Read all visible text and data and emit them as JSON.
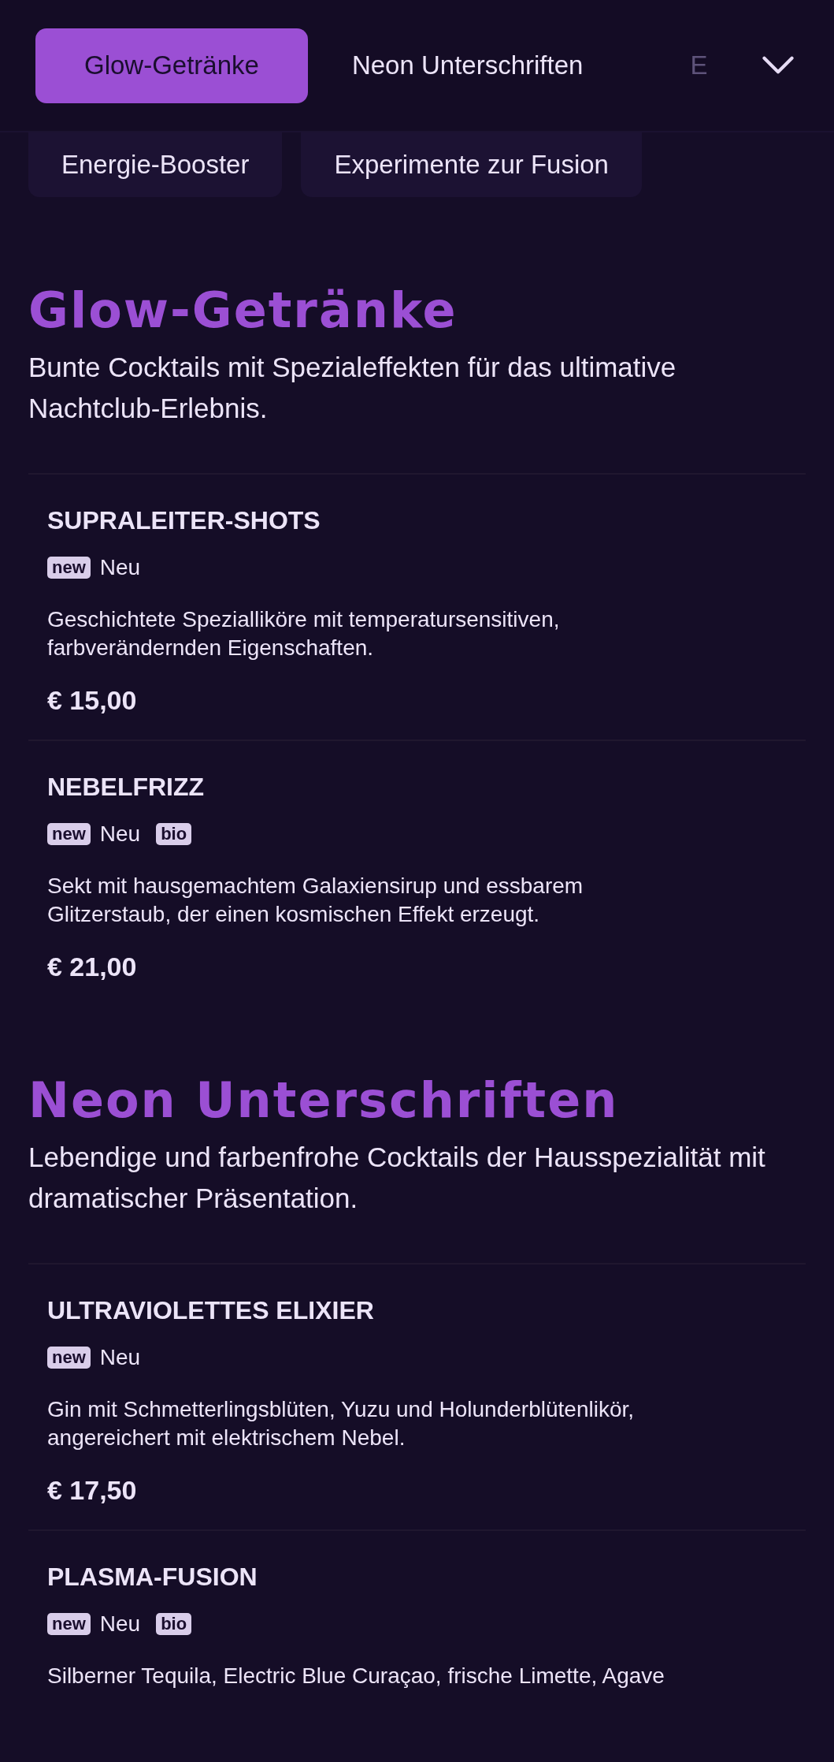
{
  "tabs": [
    {
      "label": "Glow-Getränke",
      "selected": true
    },
    {
      "label": "Neon Unterschriften",
      "selected": false
    },
    {
      "label": "E",
      "selected": false,
      "faded": true
    }
  ],
  "chips": [
    "Energie-Booster",
    "Experimente zur Fusion"
  ],
  "sections": [
    {
      "title": "Glow-Getränke",
      "description": "Bunte Cocktails mit Spezialeffekten für das ultimative Nachtclub-Erlebnis.",
      "items": [
        {
          "name": "SUPRALEITER-SHOTS",
          "tags": [
            {
              "badge": "new",
              "label": "Neu"
            }
          ],
          "description": "Geschichtete Spezialliköre mit temperatursensitiven, farbverändernden Eigenschaften.",
          "price": "€ 15,00"
        },
        {
          "name": "NEBELFRIZZ",
          "tags": [
            {
              "badge": "new",
              "label": "Neu"
            },
            {
              "badge": "bio"
            }
          ],
          "description": "Sekt mit hausgemachtem Galaxiensirup und essbarem Glitzerstaub, der einen kosmischen Effekt erzeugt.",
          "price": "€ 21,00"
        }
      ]
    },
    {
      "title": "Neon Unterschriften",
      "description": "Lebendige und farbenfrohe Cocktails der Hausspezialität mit dramatischer Präsentation.",
      "items": [
        {
          "name": "ULTRAVIOLETTES ELIXIER",
          "tags": [
            {
              "badge": "new",
              "label": "Neu"
            }
          ],
          "description": "Gin mit Schmetterlingsblüten, Yuzu und Holunderblütenlikör, angereichert mit elektrischem Nebel.",
          "price": "€ 17,50"
        },
        {
          "name": "PLASMA-FUSION",
          "tags": [
            {
              "badge": "new",
              "label": "Neu"
            },
            {
              "badge": "bio"
            }
          ],
          "description": "Silberner Tequila, Electric Blue Curaçao, frische Limette, Agave"
        }
      ]
    }
  ]
}
